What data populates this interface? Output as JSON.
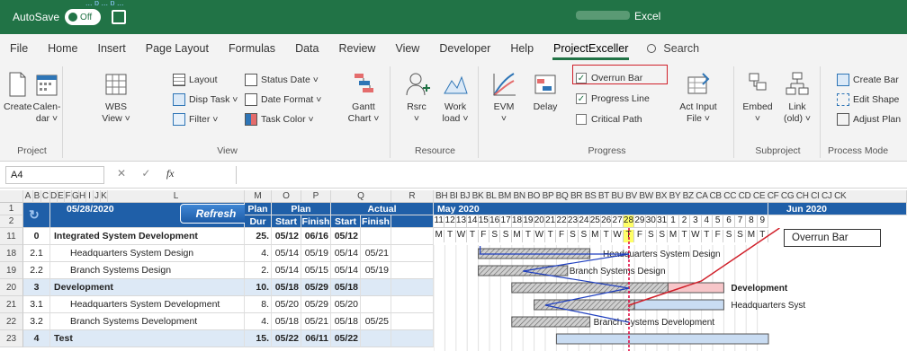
{
  "titlebar": {
    "autosave_label": "AutoSave",
    "autosave_state": "Off",
    "app_name": "Excel",
    "hint_text": "... p ... p ..."
  },
  "tabs": [
    "File",
    "Home",
    "Insert",
    "Page Layout",
    "Formulas",
    "Data",
    "Review",
    "View",
    "Developer",
    "Help",
    "ProjectExceller"
  ],
  "active_tab": "ProjectExceller",
  "search_label": "Search",
  "ribbon": {
    "project": {
      "label": "Project",
      "create": "Create",
      "calendar_1": "Calen-",
      "calendar_2": "dar ˅"
    },
    "view": {
      "label": "View",
      "wbs_1": "WBS",
      "wbs_2": "View ˅",
      "layout": "Layout",
      "disp_task": "Disp Task ˅",
      "filter": "Filter ˅",
      "status_date": "Status Date ˅",
      "date_format": "Date Format ˅",
      "task_color": "Task Color ˅",
      "gantt_1": "Gantt",
      "gantt_2": "Chart ˅"
    },
    "resource": {
      "label": "Resource",
      "rsrc_1": "Rsrc",
      "rsrc_2": "˅",
      "work_1": "Work",
      "work_2": "load ˅"
    },
    "progress": {
      "label": "Progress",
      "evm_1": "EVM",
      "evm_2": "˅",
      "delay": "Delay",
      "overrun_bar": "Overrun Bar",
      "progress_line": "Progress Line",
      "critical_path": "Critical Path",
      "overrun_checked": true,
      "progress_line_checked": true,
      "critical_path_checked": false,
      "act_input_1": "Act Input",
      "act_input_2": "File ˅"
    },
    "subproject": {
      "label": "Subproject",
      "embed_1": "Embed",
      "embed_2": "˅",
      "link_1": "Link",
      "link_2": "(old) ˅"
    },
    "process_model": {
      "label": "Process Mode",
      "create_bar": "Create Bar",
      "edit_shape": "Edit Shape",
      "adjust_plan": "Adjust Plan"
    }
  },
  "formula_bar": {
    "name_box": "A4",
    "fx": "fx",
    "cancel": "✕",
    "enter": "✓"
  },
  "sheet": {
    "columns_left": [
      "A",
      "B",
      "C",
      "D",
      "E",
      "F",
      "G",
      "H",
      "I",
      "J",
      "K",
      "L",
      "M",
      "O",
      "P",
      "Q",
      "R"
    ],
    "gantt_columns": "BH BI BJ BK BL BM BN BO BP BQ BR BS BT BU BV BW BX BY BZ CA CB CC CD CE CF CG CH CI CJ CK",
    "rows": [
      "1",
      "2",
      "11",
      "18",
      "19",
      "20",
      "21",
      "22",
      "23"
    ],
    "status_date": "05/28/2020",
    "refresh_label": "Refresh",
    "header": {
      "plan_dur_1": "Plan",
      "plan_dur_2": "Dur",
      "plan": "Plan",
      "actual": "Actual",
      "start": "Start",
      "finish": "Finish",
      "astart": "Start",
      "afinish": "Finish",
      "month_1": "May 2020",
      "month_2": "Jun 2020"
    },
    "day_numbers": [
      "11",
      "12",
      "13",
      "14",
      "15",
      "16",
      "17",
      "18",
      "19",
      "20",
      "21",
      "22",
      "23",
      "24",
      "25",
      "26",
      "27",
      "28",
      "29",
      "30",
      "31",
      "1",
      "2",
      "3",
      "4",
      "5",
      "6",
      "7",
      "8",
      "9"
    ],
    "day_letters": [
      "M",
      "T",
      "W",
      "T",
      "F",
      "S",
      "S",
      "M",
      "T",
      "W",
      "T",
      "F",
      "S",
      "S",
      "M",
      "T",
      "W",
      "T",
      "F",
      "S",
      "S",
      "M",
      "T",
      "W",
      "T",
      "F",
      "S",
      "S",
      "M",
      "T"
    ],
    "tasks": [
      {
        "wbs": "0",
        "name": "Integrated System Development",
        "dur": "25.",
        "pstart": "05/12",
        "pfinish": "06/16",
        "astart": "05/12",
        "afinish": "",
        "bold": true,
        "indent": false
      },
      {
        "wbs": "2.1",
        "name": "Headquarters System Design",
        "dur": "4.",
        "pstart": "05/14",
        "pfinish": "05/19",
        "astart": "05/14",
        "afinish": "05/21",
        "bold": false,
        "indent": true
      },
      {
        "wbs": "2.2",
        "name": "Branch Systems Design",
        "dur": "2.",
        "pstart": "05/14",
        "pfinish": "05/15",
        "astart": "05/14",
        "afinish": "05/19",
        "bold": false,
        "indent": true
      },
      {
        "wbs": "3",
        "name": "Development",
        "dur": "10.",
        "pstart": "05/18",
        "pfinish": "05/29",
        "astart": "05/18",
        "afinish": "",
        "bold": true,
        "indent": false
      },
      {
        "wbs": "3.1",
        "name": "Headquarters System Development",
        "dur": "8.",
        "pstart": "05/20",
        "pfinish": "05/29",
        "astart": "05/20",
        "afinish": "",
        "bold": false,
        "indent": true
      },
      {
        "wbs": "3.2",
        "name": "Branch Systems Development",
        "dur": "4.",
        "pstart": "05/18",
        "pfinish": "05/21",
        "astart": "05/18",
        "afinish": "05/25",
        "bold": false,
        "indent": true
      },
      {
        "wbs": "4",
        "name": "Test",
        "dur": "15.",
        "pstart": "05/22",
        "pfinish": "06/11",
        "astart": "05/22",
        "afinish": "",
        "bold": true,
        "indent": false
      }
    ],
    "bar_labels": {
      "hq_design": "Headquarters System Design",
      "branch_design": "Branch Systems Design",
      "development": "Development",
      "hq_dev": "Headquarters Syst",
      "branch_dev": "Branch Systems Development"
    },
    "callout": "Overrun Bar"
  },
  "colors": {
    "excel_green": "#217346",
    "header_blue": "#1f5fa8",
    "highlight_red": "#d0202a",
    "overrun_pink": "#f7c6c9",
    "status_yellow": "#ffff66"
  }
}
